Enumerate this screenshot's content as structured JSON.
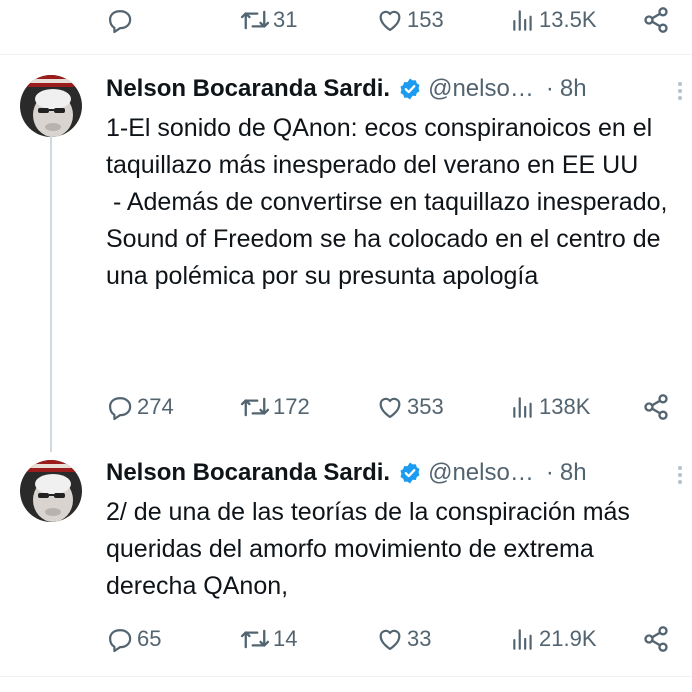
{
  "tweets": [
    {
      "stats": {
        "replies": "",
        "retweets": "31",
        "likes": "153",
        "views": "13.5K"
      }
    },
    {
      "author_name": "Nelson Bocaranda Sardi.",
      "handle": "@nelso…",
      "separator": "·",
      "time": "8h",
      "paragraphs": [
        "1-El sonido de QAnon: ecos conspiranoicos en el taquillazo más inesperado del verano en EE UU",
        " - Además de convertirse en taquillazo inesperado, Sound of Freedom se ha colocado en el centro de una polémica por su presunta apología"
      ],
      "stats": {
        "replies": "274",
        "retweets": "172",
        "likes": "353",
        "views": "138K"
      }
    },
    {
      "author_name": "Nelson Bocaranda Sardi.",
      "handle": "@nelso…",
      "separator": "·",
      "time": "8h",
      "paragraphs": [
        "2/ de una de las teorías de la conspiración más queridas del amorfo movimiento de extrema derecha QAnon,"
      ],
      "stats": {
        "replies": "65",
        "retweets": "14",
        "likes": "33",
        "views": "21.9K"
      }
    }
  ],
  "icons": {
    "reply": "reply-icon",
    "retweet": "retweet-icon",
    "like": "heart-icon",
    "views": "views-icon",
    "share": "share-icon",
    "verified": "verified-badge-icon",
    "more": "more-icon"
  },
  "colors": {
    "text": "#0f1419",
    "secondary": "#536471",
    "verified": "#1d9bf0",
    "divider": "#eff3f4",
    "thread_line": "#cfd9de"
  }
}
